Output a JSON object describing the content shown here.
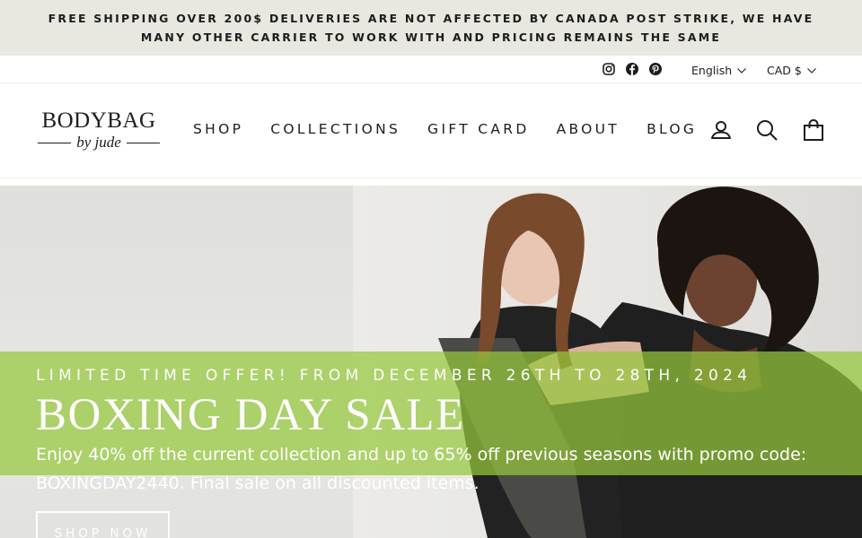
{
  "announcement": {
    "text": "FREE SHIPPING OVER 200$ DELIVERIES ARE NOT AFFECTED BY CANADA POST STRIKE, WE HAVE MANY OTHER CARRIER TO WORK WITH AND PRICING REMAINS THE SAME"
  },
  "utility": {
    "social_icons": [
      "instagram-icon",
      "facebook-icon",
      "pinterest-icon"
    ],
    "language": "English",
    "currency": "CAD $"
  },
  "header": {
    "logo_main": "BODYBAG",
    "logo_sub": "by jude",
    "nav": [
      "SHOP",
      "COLLECTIONS",
      "GIFT CARD",
      "ABOUT",
      "BLOG"
    ],
    "icons": [
      "account-icon",
      "search-icon",
      "cart-icon"
    ]
  },
  "hero": {
    "kicker": "LIMITED TIME OFFER! FROM DECEMBER 26TH TO 28TH, 2024",
    "title": "BOXING DAY SALE",
    "text": "Enjoy 40% off the current collection and up to 65% off previous seasons with promo code: BOXINGDAY2440. Final sale on all discounted items.",
    "button": "SHOP NOW",
    "band_color": "#96c83c"
  }
}
